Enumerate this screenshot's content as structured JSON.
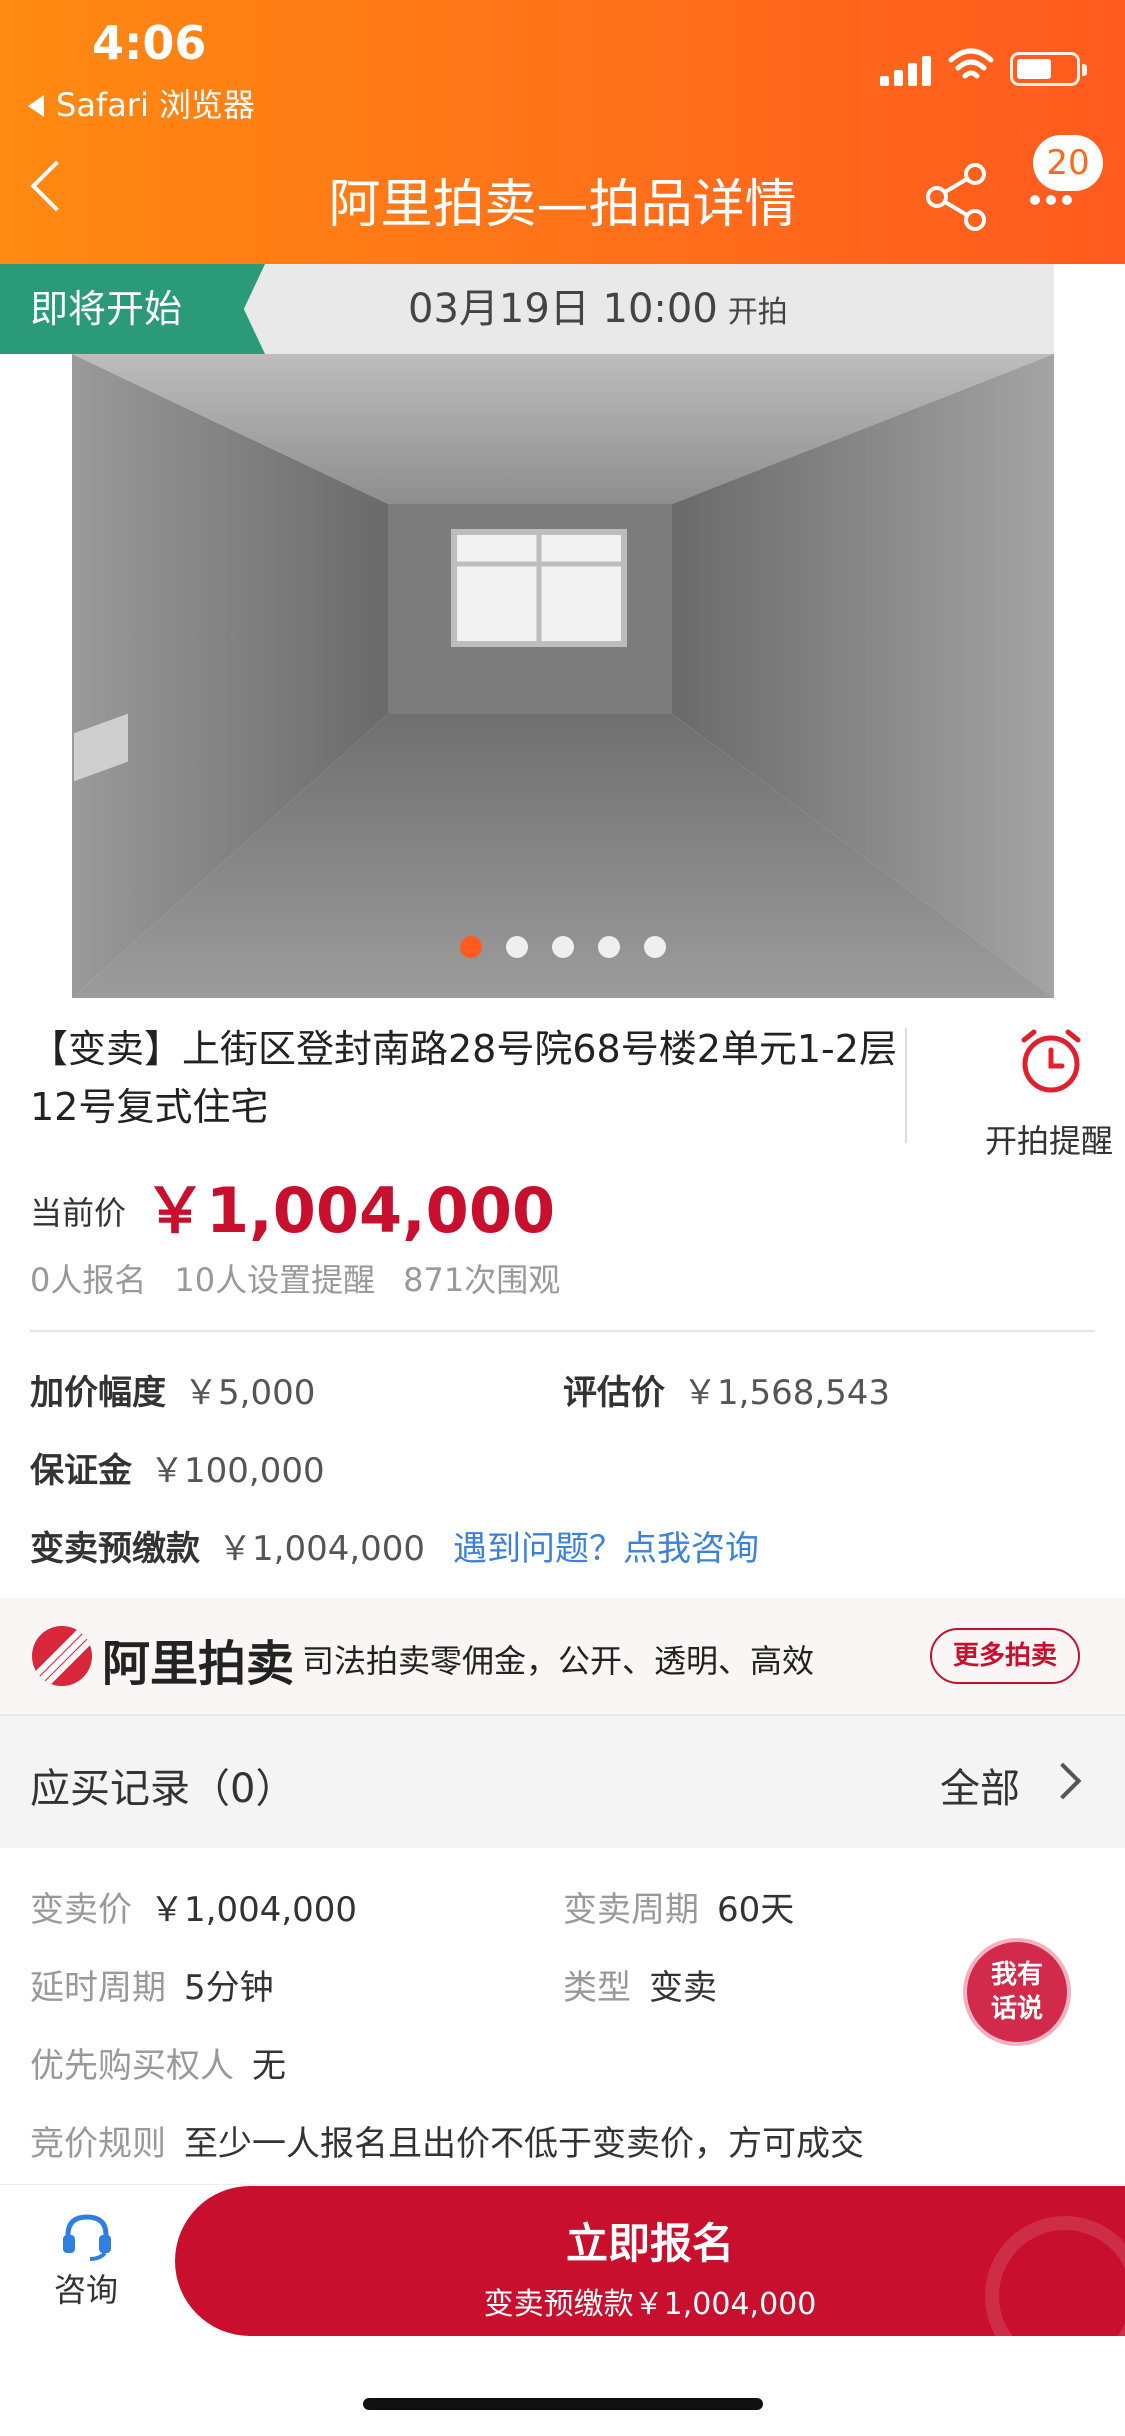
{
  "status_bar": {
    "time": "4:06",
    "back_app": "Safari 浏览器"
  },
  "nav": {
    "title": "阿里拍卖—拍品详情",
    "badge_count": "20"
  },
  "banner": {
    "tag": "即将开始",
    "datetime": "03月19日 10:00",
    "suffix": "开拍"
  },
  "carousel": {
    "total": 5,
    "active_index": 0
  },
  "item": {
    "title": "【变卖】上街区登封南路28号院68号楼2单元1-2层12号复式住宅",
    "remind_label": "开拍提醒",
    "price_label": "当前价",
    "price": "￥1,004,000",
    "stats": [
      "0人报名",
      "10人设置提醒",
      "871次围观"
    ]
  },
  "info": {
    "increment_key": "加价幅度",
    "increment_val": "￥5,000",
    "appraisal_key": "评估价",
    "appraisal_val": "￥1,568,543",
    "deposit_key": "保证金",
    "deposit_val": "￥100,000",
    "prepay_key": "变卖预缴款",
    "prepay_val": "￥1,004,000",
    "help_link": "遇到问题？点我咨询"
  },
  "promo": {
    "brand": "阿里拍卖",
    "text": "司法拍卖零佣金，公开、透明、高效",
    "button": "更多拍卖"
  },
  "records": {
    "title": "应买记录（0）",
    "all": "全部"
  },
  "details": {
    "sell_price_key": "变卖价",
    "sell_price_val": "￥1,004,000",
    "period_key": "变卖周期",
    "period_val": "60天",
    "delay_key": "延时周期",
    "delay_val": "5分钟",
    "type_key": "类型",
    "type_val": "变卖",
    "priority_key": "优先购买权人",
    "priority_val": "无",
    "rule_key": "竞价规则",
    "rule_val": "至少一人报名且出价不低于变卖价，方可成交"
  },
  "chat_fab": {
    "line1": "我有",
    "line2": "话说"
  },
  "bottom_bar": {
    "consult": "咨询",
    "signup": "立即报名",
    "signup_sub": "变卖预缴款￥1,004,000"
  },
  "colors": {
    "header": "#ff7a1a",
    "accent": "#c8102e",
    "tag": "#2b9a78",
    "link": "#3b82d9"
  }
}
